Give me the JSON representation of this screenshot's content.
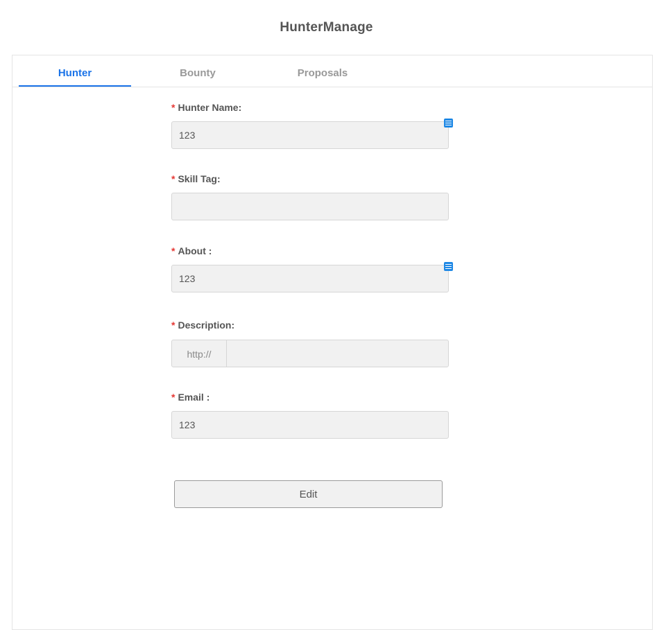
{
  "header": {
    "title": "HunterManage"
  },
  "tabs": [
    {
      "label": "Hunter",
      "active": true
    },
    {
      "label": "Bounty",
      "active": false
    },
    {
      "label": "Proposals",
      "active": false
    }
  ],
  "form": {
    "required_marker": "*",
    "hunter_name": {
      "label": "Hunter Name:",
      "value": "123"
    },
    "skill_tag": {
      "label": "Skill Tag:",
      "value": ""
    },
    "about": {
      "label": "About :",
      "value": "123"
    },
    "description": {
      "label": "Description:",
      "addon": "http://",
      "value": ""
    },
    "email": {
      "label": "Email :",
      "value": "123"
    }
  },
  "actions": {
    "edit_label": "Edit"
  },
  "colors": {
    "accent": "#1a73e8",
    "required": "#e53935",
    "input_bg": "#f1f1f1",
    "icon_bg": "#1e88e5"
  },
  "icons": {
    "field_helper": "list-icon"
  }
}
